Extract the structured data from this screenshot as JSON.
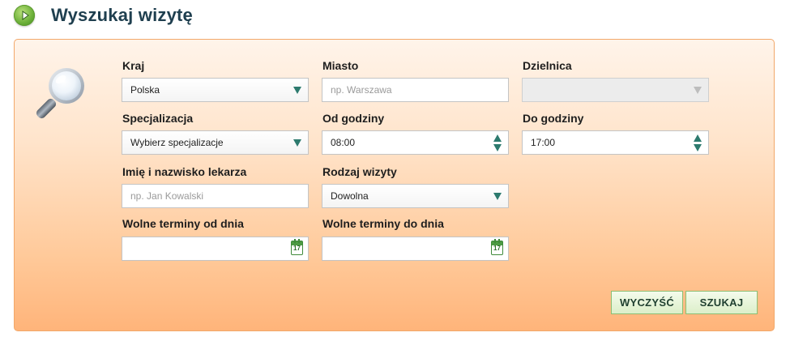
{
  "header": {
    "title": "Wyszukaj wizytę"
  },
  "form": {
    "kraj": {
      "label": "Kraj",
      "value": "Polska"
    },
    "miasto": {
      "label": "Miasto",
      "placeholder": "np. Warszawa"
    },
    "dzielnica": {
      "label": "Dzielnica",
      "value": ""
    },
    "specjalizacja": {
      "label": "Specjalizacja",
      "value": "Wybierz specjalizacje"
    },
    "od_godziny": {
      "label": "Od godziny",
      "value": "08:00"
    },
    "do_godziny": {
      "label": "Do godziny",
      "value": "17:00"
    },
    "lekarz": {
      "label": "Imię i nazwisko lekarza",
      "placeholder": "np. Jan Kowalski"
    },
    "rodzaj_wizyty": {
      "label": "Rodzaj wizyty",
      "value": "Dowolna"
    },
    "od_dnia": {
      "label": "Wolne terminy od dnia",
      "value": "",
      "calendar_day": "17"
    },
    "do_dnia": {
      "label": "Wolne terminy do dnia",
      "value": "",
      "calendar_day": "17"
    }
  },
  "buttons": {
    "clear": "WYCZYŚĆ",
    "search": "SZUKAJ"
  },
  "icons": [
    "play-icon",
    "magnifier-icon",
    "dropdown-arrow-icon",
    "time-stepper-icon",
    "calendar-icon"
  ],
  "colors": {
    "accent_green": "#6fb23b",
    "arrow_teal": "#2d7a6e",
    "panel_orange": "#ffc999",
    "title_navy": "#1f3f4f"
  }
}
